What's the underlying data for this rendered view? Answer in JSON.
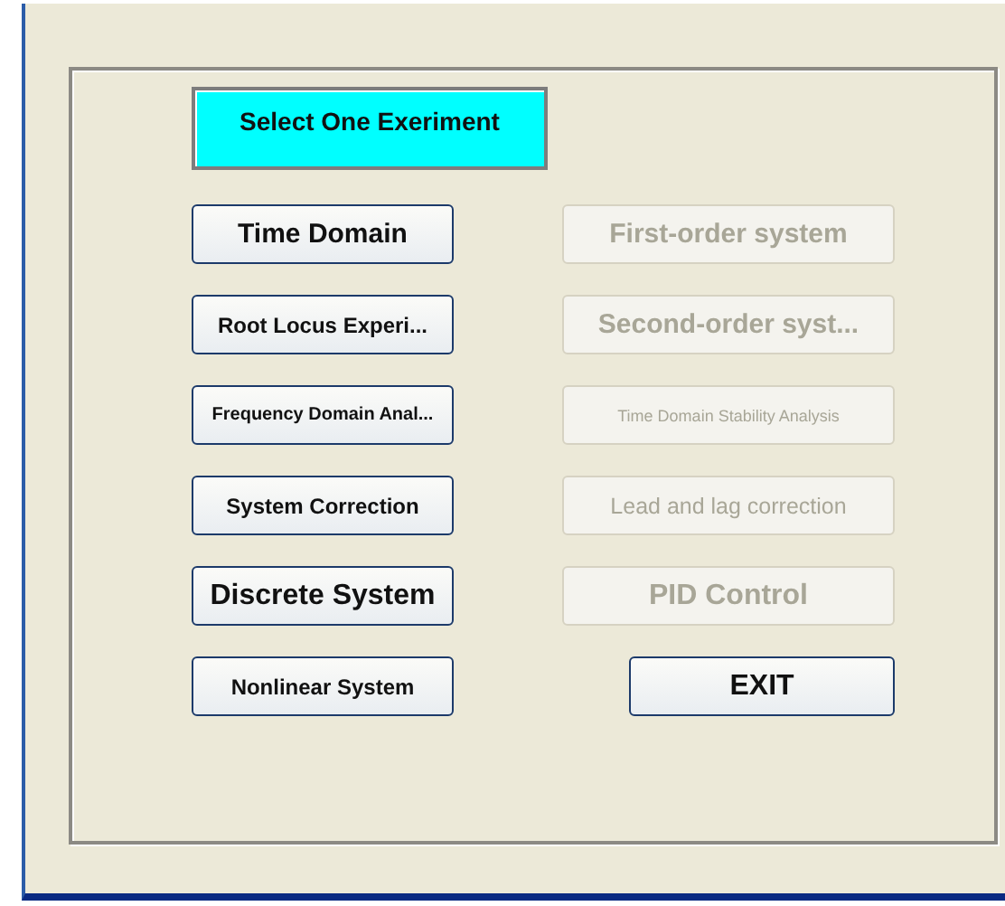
{
  "header": {
    "label": "Select One Exeriment"
  },
  "rows": [
    {
      "left": {
        "label": "Time Domain",
        "disabled": false
      },
      "right": {
        "label": "First-order system",
        "disabled": true
      }
    },
    {
      "left": {
        "label": "Root Locus Experi...",
        "disabled": false
      },
      "right": {
        "label": "Second-order syst...",
        "disabled": true
      }
    },
    {
      "left": {
        "label": "Frequency Domain Anal...",
        "disabled": false
      },
      "right": {
        "label": "Time Domain Stability Analysis",
        "disabled": true
      }
    },
    {
      "left": {
        "label": "System Correction",
        "disabled": false
      },
      "right": {
        "label": "Lead and lag correction",
        "disabled": true
      }
    },
    {
      "left": {
        "label": "Discrete System",
        "disabled": false
      },
      "right": {
        "label": "PID Control",
        "disabled": true
      }
    },
    {
      "left": {
        "label": "Nonlinear System",
        "disabled": false
      },
      "right": {
        "label": "EXIT",
        "disabled": false
      }
    }
  ]
}
